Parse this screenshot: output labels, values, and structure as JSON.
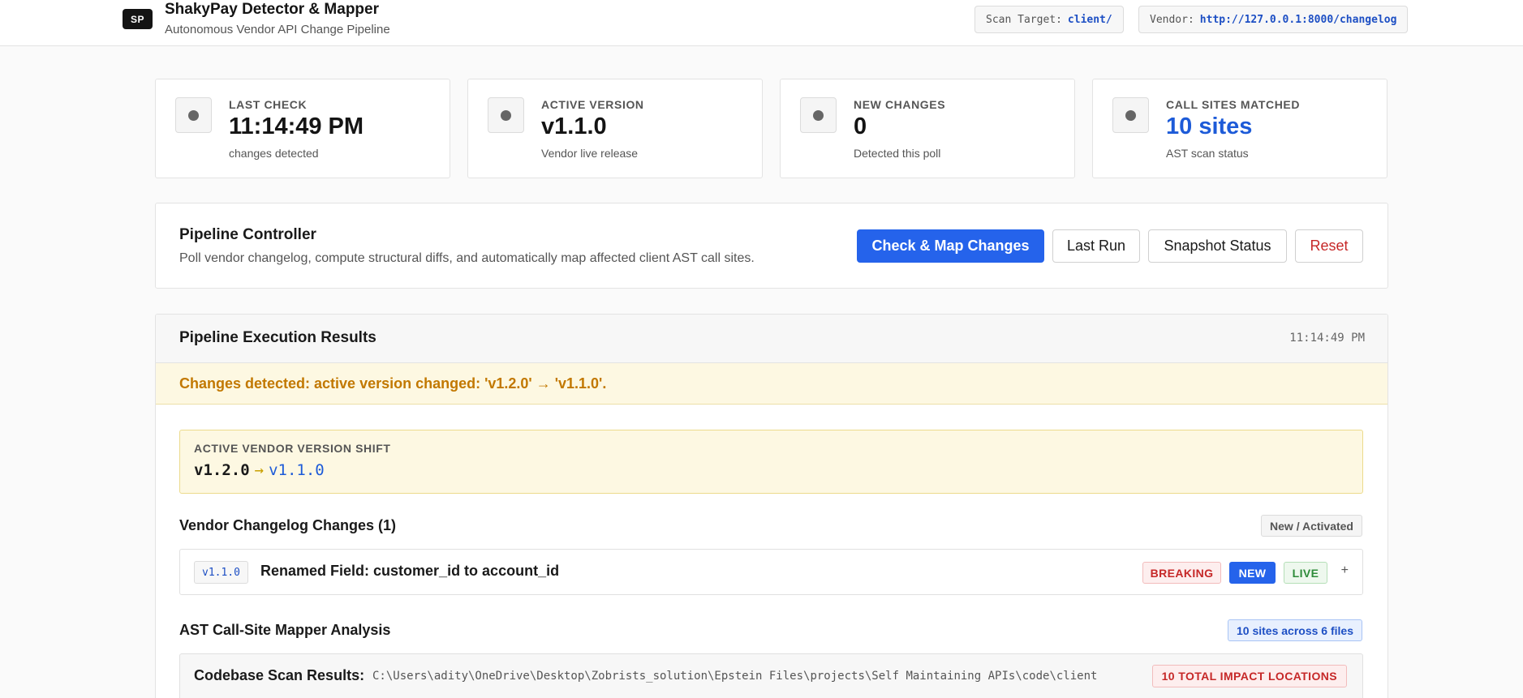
{
  "header": {
    "logo": "SP",
    "title": "ShakyPay Detector & Mapper",
    "subtitle": "Autonomous Vendor API Change Pipeline",
    "scan_target_label": "Scan Target:",
    "scan_target_value": "client/",
    "vendor_label": "Vendor:",
    "vendor_value": "http://127.0.0.1:8000/changelog"
  },
  "stats": [
    {
      "label": "LAST CHECK",
      "value": "11:14:49 PM",
      "sub": "changes detected",
      "icon": "status-dot-icon"
    },
    {
      "label": "ACTIVE VERSION",
      "value": "v1.1.0",
      "sub": "Vendor live release",
      "icon": "status-dot-icon"
    },
    {
      "label": "NEW CHANGES",
      "value": "0",
      "sub": "Detected this poll",
      "icon": "status-dot-icon"
    },
    {
      "label": "CALL SITES MATCHED",
      "value": "10 sites",
      "sub": "AST scan status",
      "icon": "status-dot-icon",
      "accent": "#1d5bd8"
    }
  ],
  "controller": {
    "title": "Pipeline Controller",
    "description": "Poll vendor changelog, compute structural diffs, and automatically map affected client AST call sites.",
    "check_button": "Check & Map Changes",
    "last_run_button": "Last Run",
    "snapshot_button": "Snapshot Status",
    "reset_button": "Reset"
  },
  "results": {
    "title": "Pipeline Execution Results",
    "timestamp": "11:14:49 PM",
    "banner": "Changes detected: active version changed: 'v1.2.0' → 'v1.1.0'.",
    "version_shift": {
      "label": "ACTIVE VENDOR VERSION SHIFT",
      "from": "v1.2.0",
      "arrow": "→",
      "to": "v1.1.0"
    },
    "changelog": {
      "title": "Vendor Changelog Changes (1)",
      "tag": "New / Activated",
      "items": [
        {
          "version": "v1.1.0",
          "title": "Renamed Field: customer_id to account_id",
          "badges": [
            "BREAKING",
            "NEW",
            "LIVE"
          ],
          "expand": "+"
        }
      ]
    },
    "mapper": {
      "title": "AST Call-Site Mapper Analysis",
      "tag": "10 sites across 6 files",
      "scan_label": "Codebase Scan Results:",
      "scan_path": "C:\\Users\\adity\\OneDrive\\Desktop\\Zobrists_solution\\Epstein Files\\projects\\Self Maintaining APIs\\code\\client",
      "scan_badge": "10 TOTAL IMPACT LOCATIONS"
    }
  },
  "colors": {
    "primary": "#2563eb",
    "warning_bg": "#fdf8e2",
    "warning_text": "#c27800",
    "danger": "#c62828",
    "success": "#2e8b3a"
  }
}
